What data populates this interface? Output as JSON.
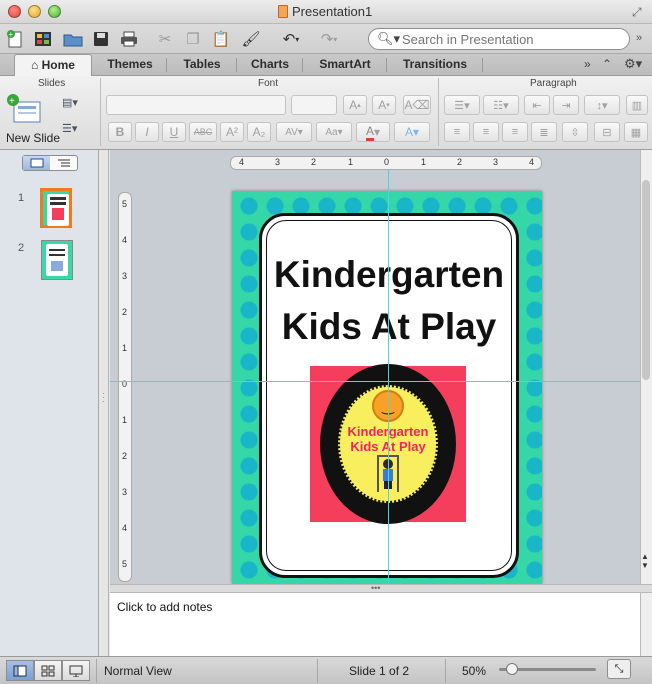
{
  "window": {
    "title": "Presentation1"
  },
  "toolbar": {
    "search_placeholder": "Search in Presentation"
  },
  "tabs": [
    {
      "label": "Home",
      "active": true
    },
    {
      "label": "Themes"
    },
    {
      "label": "Tables"
    },
    {
      "label": "Charts"
    },
    {
      "label": "SmartArt"
    },
    {
      "label": "Transitions"
    }
  ],
  "ribbon": {
    "groups": {
      "slides": "Slides",
      "font": "Font",
      "paragraph": "Paragraph"
    },
    "new_slide_label": "New Slide"
  },
  "thumbnails": [
    {
      "number": "1",
      "selected": true
    },
    {
      "number": "2",
      "selected": false
    }
  ],
  "rulers": {
    "horizontal": [
      "4",
      "3",
      "2",
      "1",
      "0",
      "1",
      "2",
      "3",
      "4"
    ],
    "vertical": [
      "5",
      "4",
      "3",
      "2",
      "1",
      "0",
      "1",
      "2",
      "3",
      "4",
      "5"
    ]
  },
  "slide": {
    "title_line1": "Kindergarten",
    "title_line2": "Kids At Play",
    "logo_line1": "Kindergarten",
    "logo_line2": "Kids At Play",
    "bg_color": "#35d6a7",
    "dot_color": "#19b5c8",
    "logo_bg_color": "#f43e5b"
  },
  "notes": {
    "placeholder": "Click to add notes"
  },
  "status": {
    "view": "Normal View",
    "slide_counter": "Slide 1 of 2",
    "zoom": "50%"
  }
}
